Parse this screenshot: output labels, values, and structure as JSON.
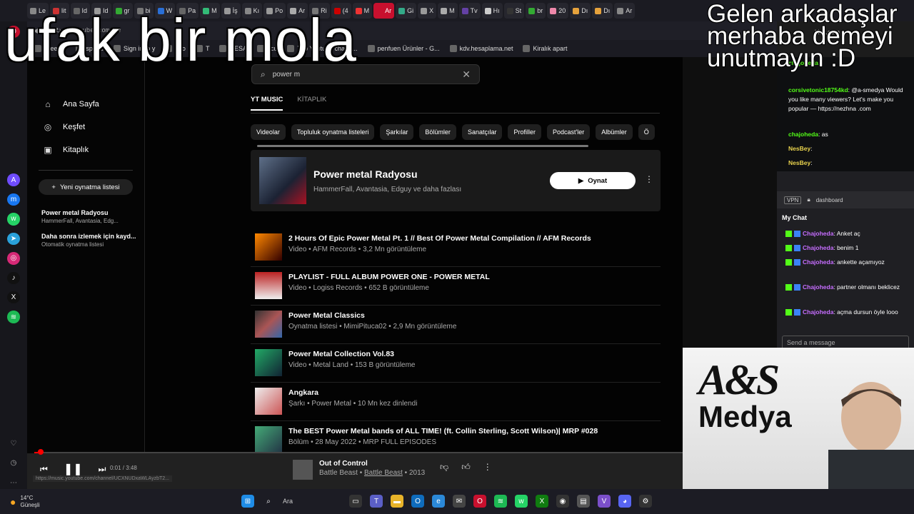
{
  "browser": {
    "tabs": [
      "Le",
      "lit",
      "Id",
      "Id",
      "gr",
      "bi",
      "W",
      "Pa",
      "M",
      "İş",
      "Kı",
      "Po",
      "Ar",
      "Ri",
      "(4",
      "M",
      "Ar",
      "Gi",
      "X",
      "M",
      "Tv",
      "Hı",
      "St",
      "br",
      "20",
      "Dı",
      "Dı",
      "Ar"
    ],
    "url": "youtube.com/se",
    "bookmarks": [
      "Free Te",
      "speed",
      "Sign in to y",
      "ayo",
      "T",
      "HESA",
      "ocu",
      "Top Youtube chann...",
      "penfuen Ürünler - G...",
      "kdv.hesaplama.net",
      "Kiralık apart"
    ]
  },
  "ytm": {
    "nav": [
      "Ana Sayfa",
      "Keşfet",
      "Kitaplık"
    ],
    "new_playlist": "Yeni oynatma listesi",
    "playlists": [
      {
        "title": "Power metal Radyosu",
        "sub": "HammerFall, Avantasia, Edg..."
      },
      {
        "title": "Daha sonra izlemek için kayd...",
        "sub": "Otomatik oynatma listesi"
      }
    ],
    "search_value": "power m",
    "tabs": [
      "YT MUSIC",
      "KİTAPLIK"
    ],
    "chips": [
      "Videolar",
      "Topluluk oynatma listeleri",
      "Şarkılar",
      "Bölümler",
      "Sanatçılar",
      "Profiller",
      "Podcast'ler",
      "Albümler",
      "Ö"
    ],
    "top": {
      "title": "Power metal Radyosu",
      "sub": "HammerFall, Avantasia, Edguy ve daha fazlası",
      "play": "Oynat"
    },
    "results": [
      {
        "title": "2 Hours Of Epic Power Metal Pt. 1 // Best Of Power Metal Compilation // AFM Records",
        "sub": "Video • AFM Records • 3,2 Mn görüntüleme"
      },
      {
        "title": "PLAYLIST - FULL ALBUM POWER ONE - POWER METAL",
        "sub": "Video • Logiss Records • 652 B görüntüleme"
      },
      {
        "title": "Power Metal Classics",
        "sub": "Oynatma listesi • MimiPituca02 • 2,9 Mn görüntüleme"
      },
      {
        "title": "Power Metal Collection Vol.83",
        "sub": "Video • Metal Land • 153 B görüntüleme"
      },
      {
        "title": "Angkara",
        "sub": "Şarkı • Power Metal • 10 Mn kez dinlendi"
      },
      {
        "title": "The BEST Power Metal bands of ALL TIME! (ft. Collin Sterling, Scott Wilson)| MRP #028",
        "sub": "Bölüm • 28 May 2022 • MRP FULL EPISODES"
      }
    ],
    "player": {
      "time": "0:01 / 3:48",
      "progress": 0.005,
      "title": "Out of Control",
      "artist": "Battle Beast",
      "album": "Battle Beast",
      "year": "2013",
      "tooltip": "https://music.youtube.com/channel/UCXNUDxaWLAyzbT2..."
    }
  },
  "kick": {
    "url": "kick.com",
    "top_messages": [
      {
        "name": "chajoheda",
        "text": ""
      },
      {
        "name": "corsivetonic18754kd",
        "text": ": @a-smedya Would you like many viewers? Let's make you popular — https://nezhna .com"
      },
      {
        "name": "chajoheda",
        "text": ": as"
      },
      {
        "name": "NesBey",
        "text": ":"
      },
      {
        "name": "NesBey",
        "text": ":"
      }
    ],
    "chat_url": "dashboard",
    "chat_title": "My Chat",
    "messages": [
      {
        "name": "Chajoheda",
        "text": ": Anket aç"
      },
      {
        "name": "Chajoheda",
        "text": ": benim 1"
      },
      {
        "name": "Chajoheda",
        "text": ": ankette açamıyoz"
      },
      {
        "name": "Chajoheda",
        "text": ": partner olmanı beklicez"
      },
      {
        "name": "Chajoheda",
        "text": ": açma dursun öyle looo"
      }
    ],
    "send_placeholder": "Send a message"
  },
  "cam": {
    "logo_line1": "A&S",
    "logo_line2": "Medya"
  },
  "taskbar": {
    "temp": "14°C",
    "weather": "Güneşli",
    "search": "Ara"
  },
  "overlay": {
    "left_text": "ufak bir mola",
    "right_text": "Gelen arkadaşlar merhaba demeyi unutmayın :D"
  }
}
